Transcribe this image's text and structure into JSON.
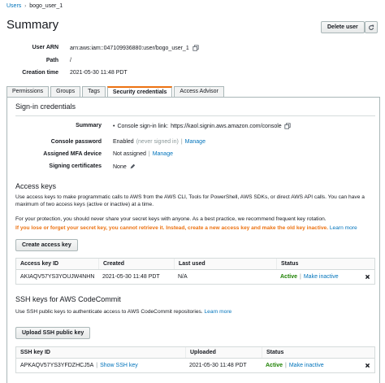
{
  "breadcrumb": {
    "root": "Users",
    "separator": "›",
    "current": "bogo_user_1"
  },
  "page": {
    "title": "Summary",
    "delete_label": "Delete user"
  },
  "summary": {
    "arn_label": "User ARN",
    "arn_value": "arn:aws:iam::047109936880:user/bogo_user_1",
    "path_label": "Path",
    "path_value": "/",
    "created_label": "Creation time",
    "created_value": "2021-05-30 11:48 PDT"
  },
  "tabs": [
    {
      "label": "Permissions"
    },
    {
      "label": "Groups"
    },
    {
      "label": "Tags"
    },
    {
      "label": "Security credentials"
    },
    {
      "label": "Access Advisor"
    }
  ],
  "signin": {
    "title": "Sign-in credentials",
    "summary_label": "Summary",
    "summary_prefix": "Console sign-in link:",
    "summary_link": "https://kaol.signin.aws.amazon.com/console",
    "console_password_label": "Console password",
    "console_password_value": "Enabled",
    "console_password_note": "(never signed in)",
    "console_password_separator": "|",
    "manage_label": "Manage",
    "mfa_label": "Assigned MFA device",
    "mfa_value": "Not assigned",
    "mfa_separator": "|",
    "mfa_manage": "Manage",
    "cert_label": "Signing certificates",
    "cert_value": "None"
  },
  "access_keys": {
    "title": "Access keys",
    "desc": "Use access keys to make programmatic calls to AWS from the AWS CLI, Tools for PowerShell, AWS SDKs, or direct AWS API calls. You can have a maximum of two access keys (active or inactive) at a time.",
    "protect": "For your protection, you should never share your secret keys with anyone. As a best practice, we recommend frequent key rotation.",
    "warning": "If you lose or forget your secret key, you cannot retrieve it. Instead, create a new access key and make the old key inactive.",
    "learn_more": "Learn more",
    "create_button": "Create access key",
    "columns": [
      "Access key ID",
      "Created",
      "Last used",
      "Status"
    ],
    "rows": [
      {
        "id": "AKIAQV57YS3YOUJW4NHN",
        "created": "2021-05-30 11:48 PDT",
        "last_used": "N/A",
        "status": "Active",
        "separator": "|",
        "action": "Make inactive"
      }
    ]
  },
  "ssh": {
    "title": "SSH keys for AWS CodeCommit",
    "desc": "Use SSH public keys to authenticate access to AWS CodeCommit repositories.",
    "learn_more": "Learn more",
    "upload_button": "Upload SSH public key",
    "columns": [
      "SSH key ID",
      "Uploaded",
      "Status"
    ],
    "rows": [
      {
        "id": "APKAQV57YS3YFDZHCJ5A",
        "separator": "|",
        "show_link": "Show SSH key",
        "uploaded": "2021-05-30 11:48 PDT",
        "status": "Active",
        "status_separator": "|",
        "action": "Make inactive"
      }
    ]
  },
  "icons": {
    "refresh": "refresh-icon",
    "copy": "copy-icon",
    "edit": "pencil-icon",
    "delete": "x-icon"
  }
}
